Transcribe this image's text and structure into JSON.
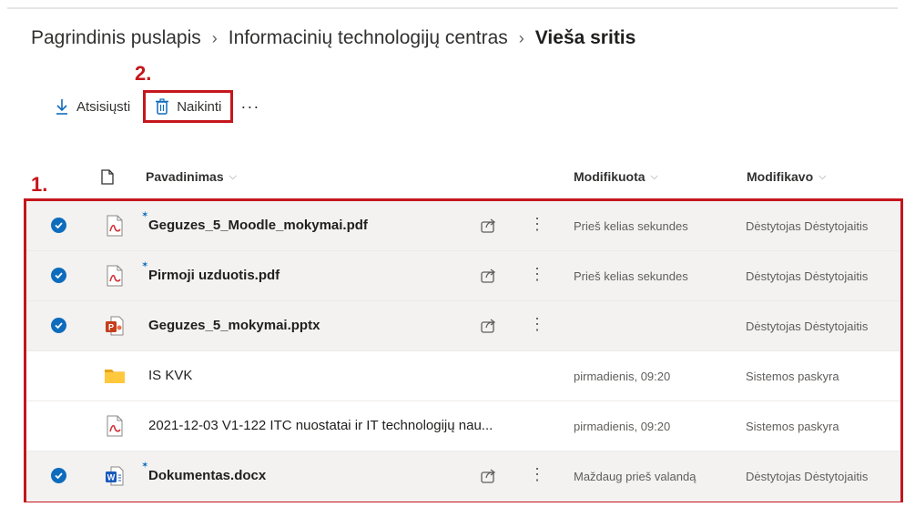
{
  "breadcrumb": {
    "items": [
      "Pagrindinis puslapis",
      "Informacinių technologijų centras"
    ],
    "current": "Vieša sritis",
    "separator": "›"
  },
  "toolbar": {
    "download_label": "Atsisiųsti",
    "delete_label": "Naikinti",
    "more_label": "···"
  },
  "annotations": {
    "step1": "1.",
    "step2": "2."
  },
  "table": {
    "columns": {
      "name": "Pavadinimas",
      "modified": "Modifikuota",
      "modified_by": "Modifikavo",
      "sort_glyph": "⌵"
    },
    "rows": [
      {
        "name": "Geguzes_5_Moodle_mokymai.pdf",
        "type": "pdf",
        "selected": true,
        "new": true,
        "modified": "Prieš kelias sekundes",
        "modified_by": "Dėstytojas Dėstytojaitis"
      },
      {
        "name": "Pirmoji uzduotis.pdf",
        "type": "pdf",
        "selected": true,
        "new": true,
        "modified": "Prieš kelias sekundes",
        "modified_by": "Dėstytojas Dėstytojaitis"
      },
      {
        "name": "Geguzes_5_mokymai.pptx",
        "type": "pptx",
        "selected": true,
        "new": false,
        "modified": "",
        "modified_by": "Dėstytojas Dėstytojaitis"
      },
      {
        "name": "IS KVK",
        "type": "folder",
        "selected": false,
        "new": false,
        "modified": "pirmadienis, 09:20",
        "modified_by": "Sistemos paskyra"
      },
      {
        "name": "2021-12-03 V1-122 ITC nuostatai ir IT technologijų nau...",
        "type": "pdf",
        "selected": false,
        "new": false,
        "modified": "pirmadienis, 09:20",
        "modified_by": "Sistemos paskyra"
      },
      {
        "name": "Dokumentas.docx",
        "type": "docx",
        "selected": true,
        "new": true,
        "modified": "Maždaug prieš valandą",
        "modified_by": "Dėstytojas Dėstytojaitis"
      }
    ]
  },
  "colors": {
    "accent": "#0f6cbd",
    "annotation": "#c4161c",
    "selected_row": "#f3f2f1",
    "pdf": "#d13438",
    "ppt": "#c43e1c",
    "word": "#185abd",
    "folder": "#ffc83d"
  }
}
